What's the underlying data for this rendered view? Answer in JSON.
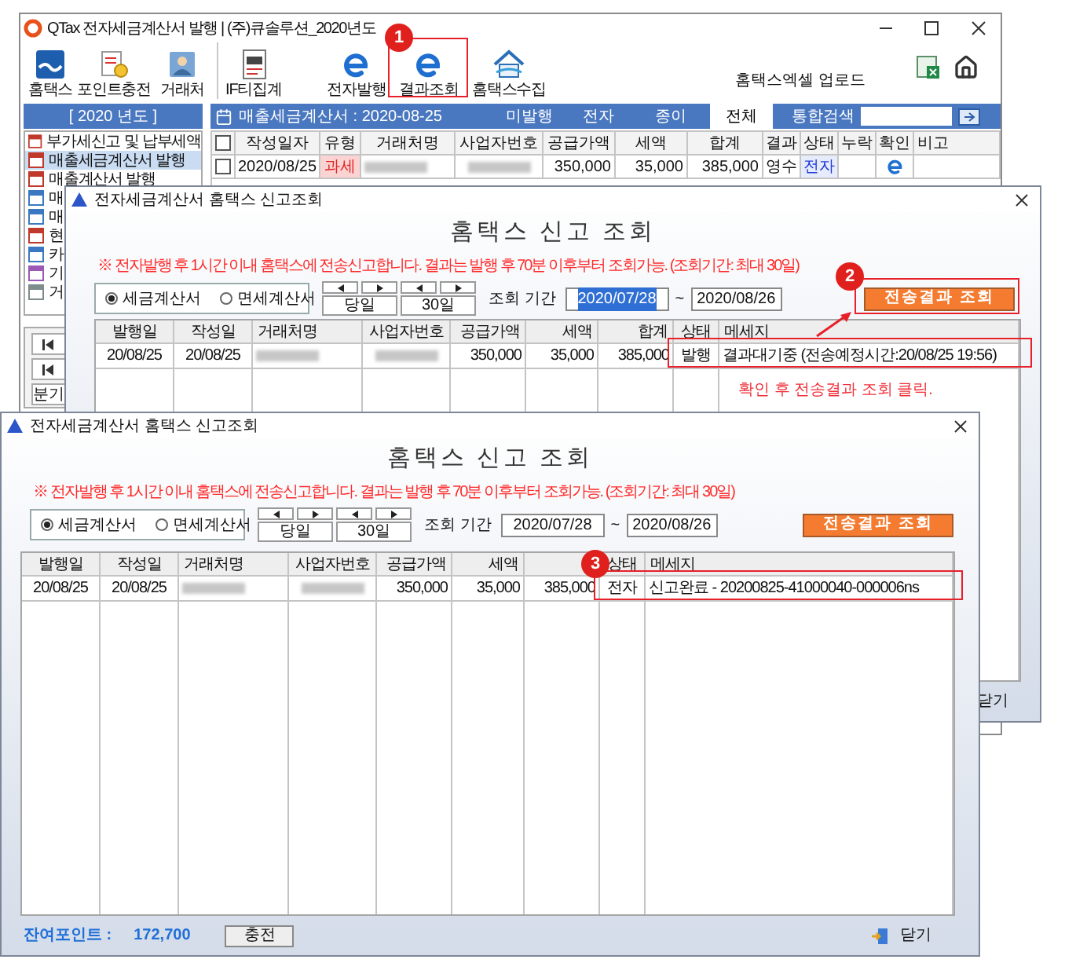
{
  "main_window": {
    "title": "QTax 전자세금계산서 발행 | (주)큐솔루션_2020년도",
    "toolbar": [
      {
        "label": "홈택스",
        "kind": "hometax"
      },
      {
        "label": "포인트충전",
        "kind": "points"
      },
      {
        "label": "거래처",
        "kind": "clients"
      },
      {
        "label": "IF티집계",
        "kind": "summary"
      },
      {
        "label": "전자발행",
        "kind": "e"
      },
      {
        "label": "결과조회",
        "kind": "e"
      },
      {
        "label": "홈택스수집",
        "kind": "house"
      }
    ],
    "excel_upload": "홈택스엑셀 업로드",
    "year": "[ 2020 년도 ]",
    "sidebar": {
      "items": [
        {
          "label": "부가세신고 및 납부세액",
          "selected": false
        },
        {
          "label": "매출세금계산서 발행",
          "selected": true
        },
        {
          "label": "매출계산서 발행",
          "selected": false
        },
        {
          "label": "매",
          "selected": false
        },
        {
          "label": "매",
          "selected": false
        },
        {
          "label": "현",
          "selected": false
        },
        {
          "label": "카",
          "selected": false
        },
        {
          "label": "기",
          "selected": false
        },
        {
          "label": "거",
          "selected": false
        }
      ],
      "buttons": [
        {
          "kind": "first"
        },
        {
          "kind": "first"
        },
        {
          "kind": "text",
          "label": "분기"
        }
      ]
    },
    "list_title": "매출세금계산서 : 2020-08-25",
    "filter_tabs": [
      {
        "label": "미발행",
        "selected": false
      },
      {
        "label": "전자",
        "selected": false
      },
      {
        "label": "종이",
        "selected": false
      },
      {
        "label": "전체",
        "selected": true
      }
    ],
    "search_label": "통합검색",
    "table": {
      "header_checked": false,
      "columns": [
        "작성일자",
        "유형",
        "거래처명",
        "사업자번호",
        "공급가액",
        "세액",
        "합계",
        "결과",
        "상태",
        "누락",
        "확인",
        "비고"
      ],
      "rows": [
        {
          "checked": false,
          "cells": [
            {
              "kind": "text",
              "text": "2020/08/25"
            },
            {
              "kind": "flag",
              "text": "과세"
            },
            {
              "kind": "redacted"
            },
            {
              "kind": "redacted"
            },
            {
              "kind": "text",
              "text": "350,000"
            },
            {
              "kind": "text",
              "text": "35,000"
            },
            {
              "kind": "text",
              "text": "385,000"
            },
            {
              "kind": "text",
              "text": "영수"
            },
            {
              "kind": "status",
              "text": "전자"
            },
            {
              "kind": "empty"
            },
            {
              "kind": "e-icon"
            },
            {
              "kind": "empty"
            }
          ]
        }
      ]
    }
  },
  "dialogs": [
    {
      "title": "전자세금계산서 홈택스 신고조회",
      "heading": "홈택스 신고 조회",
      "notice": "※ 전자발행 후 1시간 이내 홈택스에 전송신고합니다. 결과는 발행 후 70분 이후부터 조회가능. (조회기간: 최대 30일)",
      "invoice_types": [
        {
          "label": "세금계산서",
          "selected": true
        },
        {
          "label": "면세계산서",
          "selected": false
        }
      ],
      "today": "당일",
      "days": "30일",
      "period_label": "조회 기간",
      "date_from": {
        "value": "2020/07/28",
        "selected": true
      },
      "range_sep": "~",
      "date_to": {
        "value": "2020/08/26"
      },
      "submit": "전송결과 조회",
      "table": {
        "columns": [
          {
            "label": "발행일"
          },
          {
            "label": "작성일"
          },
          {
            "label": "거래처명"
          },
          {
            "label": "사업자번호"
          },
          {
            "label": "공급가액"
          },
          {
            "label": "세액"
          },
          {
            "label": "합계"
          },
          {
            "label": "상태"
          },
          {
            "label": "메세지"
          }
        ],
        "rows": [
          {
            "cells": [
              {
                "kind": "text",
                "text": "20/08/25"
              },
              {
                "kind": "text",
                "text": "20/08/25"
              },
              {
                "kind": "redacted"
              },
              {
                "kind": "redacted"
              },
              {
                "kind": "text",
                "text": "350,000"
              },
              {
                "kind": "text",
                "text": "35,000"
              },
              {
                "kind": "text",
                "text": "385,000"
              },
              {
                "kind": "text",
                "text": "발행"
              },
              {
                "kind": "text",
                "text": "결과대기중 (전송예정시간:20/08/25 19:56)"
              }
            ]
          }
        ]
      },
      "footer": {
        "kind": "close-only",
        "close": "닫기"
      }
    },
    {
      "title": "전자세금계산서 홈택스 신고조회",
      "heading": "홈택스 신고 조회",
      "notice": "※ 전자발행 후 1시간 이내 홈택스에 전송신고합니다. 결과는 발행 후 70분 이후부터 조회가능. (조회기간: 최대 30일)",
      "invoice_types": [
        {
          "label": "세금계산서",
          "selected": true
        },
        {
          "label": "면세계산서",
          "selected": false
        }
      ],
      "today": "당일",
      "days": "30일",
      "period_label": "조회 기간",
      "date_from": {
        "value": "2020/07/28",
        "selected": false
      },
      "range_sep": "~",
      "date_to": {
        "value": "2020/08/26"
      },
      "submit": "전송결과 조회",
      "table": {
        "columns": [
          {
            "label": "발행일"
          },
          {
            "label": "작성일"
          },
          {
            "label": "거래처명"
          },
          {
            "label": "사업자번호"
          },
          {
            "label": "공급가액"
          },
          {
            "label": "세액"
          },
          {},
          {
            "label": "상태"
          },
          {
            "label": "메세지"
          }
        ],
        "rows": [
          {
            "cells": [
              {
                "kind": "text",
                "text": "20/08/25"
              },
              {
                "kind": "text",
                "text": "20/08/25"
              },
              {
                "kind": "redacted"
              },
              {
                "kind": "redacted"
              },
              {
                "kind": "text",
                "text": "350,000"
              },
              {
                "kind": "text",
                "text": "35,000"
              },
              {
                "kind": "text",
                "text": "385,000"
              },
              {
                "kind": "text",
                "text": "전자"
              },
              {
                "kind": "text",
                "text": "신고완료 - 20200825-41000040-000006ns"
              }
            ]
          }
        ]
      },
      "footer": {
        "kind": "full",
        "points_label": "잔여포인트 :",
        "points": "172,700",
        "charge": "충전",
        "close": "닫기"
      }
    }
  ],
  "annotations": {
    "badges": [
      "1",
      "2",
      "3"
    ],
    "hint": "확인 후 전송결과 조회 클릭."
  }
}
